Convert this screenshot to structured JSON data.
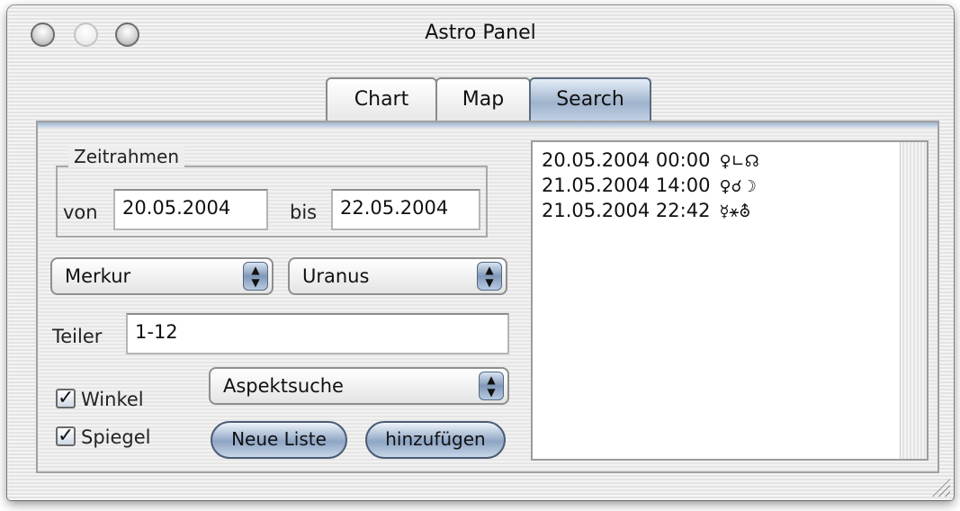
{
  "window": {
    "title": "Astro Panel"
  },
  "tabs": [
    {
      "label": "Chart"
    },
    {
      "label": "Map"
    },
    {
      "label": "Search",
      "active": true
    }
  ],
  "timeframe": {
    "title": "Zeitrahmen",
    "from_label": "von",
    "from_value": "20.05.2004",
    "to_label": "bis",
    "to_value": "22.05.2004"
  },
  "planet1": {
    "selected": "Merkur"
  },
  "planet2": {
    "selected": "Uranus"
  },
  "divisor": {
    "label": "Teiler",
    "value": "1-12"
  },
  "search_mode": {
    "selected": "Aspektsuche"
  },
  "options": {
    "angle": {
      "label": "Winkel",
      "checked": true
    },
    "mirror": {
      "label": "Spiegel",
      "checked": true
    }
  },
  "buttons": {
    "new_list": "Neue Liste",
    "add": "hinzufügen"
  },
  "results": [
    {
      "datetime": "20.05.2004 00:00",
      "symbols": "♀∟☊"
    },
    {
      "datetime": "21.05.2004 14:00",
      "symbols": "♀☌☽"
    },
    {
      "datetime": "21.05.2004 22:42",
      "symbols": "☿⚹⛢"
    }
  ],
  "colors": {
    "accent": "#8ea5c4",
    "window_bg": "#ececec"
  }
}
